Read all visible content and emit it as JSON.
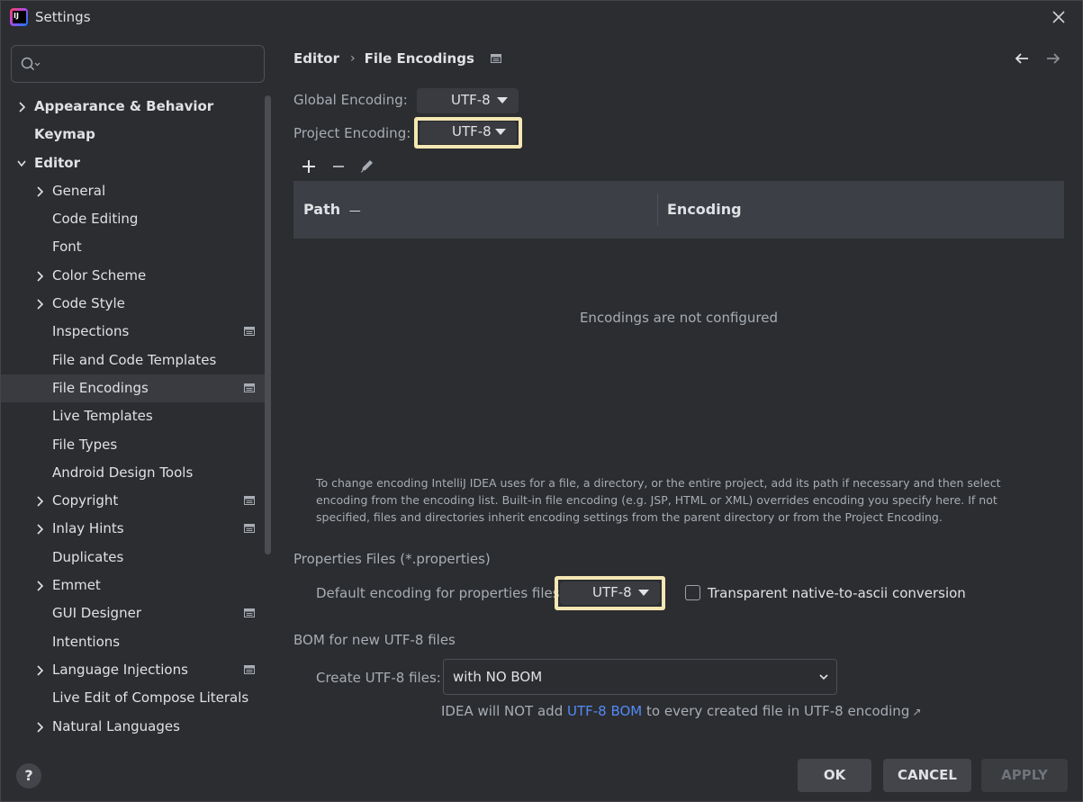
{
  "window": {
    "title": "Settings"
  },
  "search": {
    "placeholder": ""
  },
  "sidebar": {
    "items": [
      {
        "label": "Appearance & Behavior",
        "level": 0,
        "expandable": true,
        "expanded": false,
        "bold": true,
        "project_icon": false,
        "selected": false
      },
      {
        "label": "Keymap",
        "level": 0,
        "expandable": false,
        "bold": true,
        "project_icon": false,
        "selected": false
      },
      {
        "label": "Editor",
        "level": 0,
        "expandable": true,
        "expanded": true,
        "bold": true,
        "project_icon": false,
        "selected": false
      },
      {
        "label": "General",
        "level": 1,
        "expandable": true,
        "expanded": false,
        "project_icon": false,
        "selected": false
      },
      {
        "label": "Code Editing",
        "level": 1,
        "expandable": false,
        "project_icon": false,
        "selected": false
      },
      {
        "label": "Font",
        "level": 1,
        "expandable": false,
        "project_icon": false,
        "selected": false
      },
      {
        "label": "Color Scheme",
        "level": 1,
        "expandable": true,
        "expanded": false,
        "project_icon": false,
        "selected": false
      },
      {
        "label": "Code Style",
        "level": 1,
        "expandable": true,
        "expanded": false,
        "project_icon": false,
        "selected": false
      },
      {
        "label": "Inspections",
        "level": 1,
        "expandable": false,
        "project_icon": true,
        "selected": false
      },
      {
        "label": "File and Code Templates",
        "level": 1,
        "expandable": false,
        "project_icon": false,
        "selected": false
      },
      {
        "label": "File Encodings",
        "level": 1,
        "expandable": false,
        "project_icon": true,
        "selected": true
      },
      {
        "label": "Live Templates",
        "level": 1,
        "expandable": false,
        "project_icon": false,
        "selected": false
      },
      {
        "label": "File Types",
        "level": 1,
        "expandable": false,
        "project_icon": false,
        "selected": false
      },
      {
        "label": "Android Design Tools",
        "level": 1,
        "expandable": false,
        "project_icon": false,
        "selected": false
      },
      {
        "label": "Copyright",
        "level": 1,
        "expandable": true,
        "expanded": false,
        "project_icon": true,
        "selected": false
      },
      {
        "label": "Inlay Hints",
        "level": 1,
        "expandable": true,
        "expanded": false,
        "project_icon": true,
        "selected": false
      },
      {
        "label": "Duplicates",
        "level": 1,
        "expandable": false,
        "project_icon": false,
        "selected": false
      },
      {
        "label": "Emmet",
        "level": 1,
        "expandable": true,
        "expanded": false,
        "project_icon": false,
        "selected": false
      },
      {
        "label": "GUI Designer",
        "level": 1,
        "expandable": false,
        "project_icon": true,
        "selected": false
      },
      {
        "label": "Intentions",
        "level": 1,
        "expandable": false,
        "project_icon": false,
        "selected": false
      },
      {
        "label": "Language Injections",
        "level": 1,
        "expandable": true,
        "expanded": false,
        "project_icon": true,
        "selected": false
      },
      {
        "label": "Live Edit of Compose Literals",
        "level": 1,
        "expandable": false,
        "project_icon": false,
        "selected": false
      },
      {
        "label": "Natural Languages",
        "level": 1,
        "expandable": true,
        "expanded": false,
        "project_icon": false,
        "selected": false
      }
    ]
  },
  "breadcrumb": {
    "parent": "Editor",
    "current": "File Encodings"
  },
  "encodings": {
    "global_label": "Global Encoding:",
    "global_value": "UTF-8",
    "project_label": "Project Encoding:",
    "project_value": "UTF-8"
  },
  "table": {
    "columns": [
      "Path",
      "Encoding"
    ],
    "sort_indicator": "—",
    "empty_text": "Encodings are not configured"
  },
  "info_text": "To change encoding IntelliJ IDEA uses for a file, a directory, or the entire project, add its path if necessary and then select encoding from the encoding list. Built-in file encoding (e.g. JSP, HTML or XML) overrides encoding you specify here. If not specified, files and directories inherit encoding settings from the parent directory or from the Project Encoding.",
  "properties": {
    "section_title": "Properties Files (*.properties)",
    "default_label": "Default encoding for properties files:",
    "default_value": "UTF-8",
    "transparent_label": "Transparent native-to-ascii conversion",
    "transparent_checked": false
  },
  "bom": {
    "section_title": "BOM for new UTF-8 files",
    "create_label": "Create UTF-8 files:",
    "create_value": "with NO BOM",
    "note_prefix": "IDEA will NOT add ",
    "note_link": "UTF-8 BOM",
    "note_suffix": " to every created file in UTF-8 encoding",
    "note_arrow": "↗"
  },
  "footer": {
    "help": "?",
    "ok": "OK",
    "cancel": "CANCEL",
    "apply": "APPLY"
  },
  "colors": {
    "background": "#2b2d30",
    "selection": "#393b40",
    "highlight_border": "#f4e7b3",
    "link": "#548af7"
  }
}
